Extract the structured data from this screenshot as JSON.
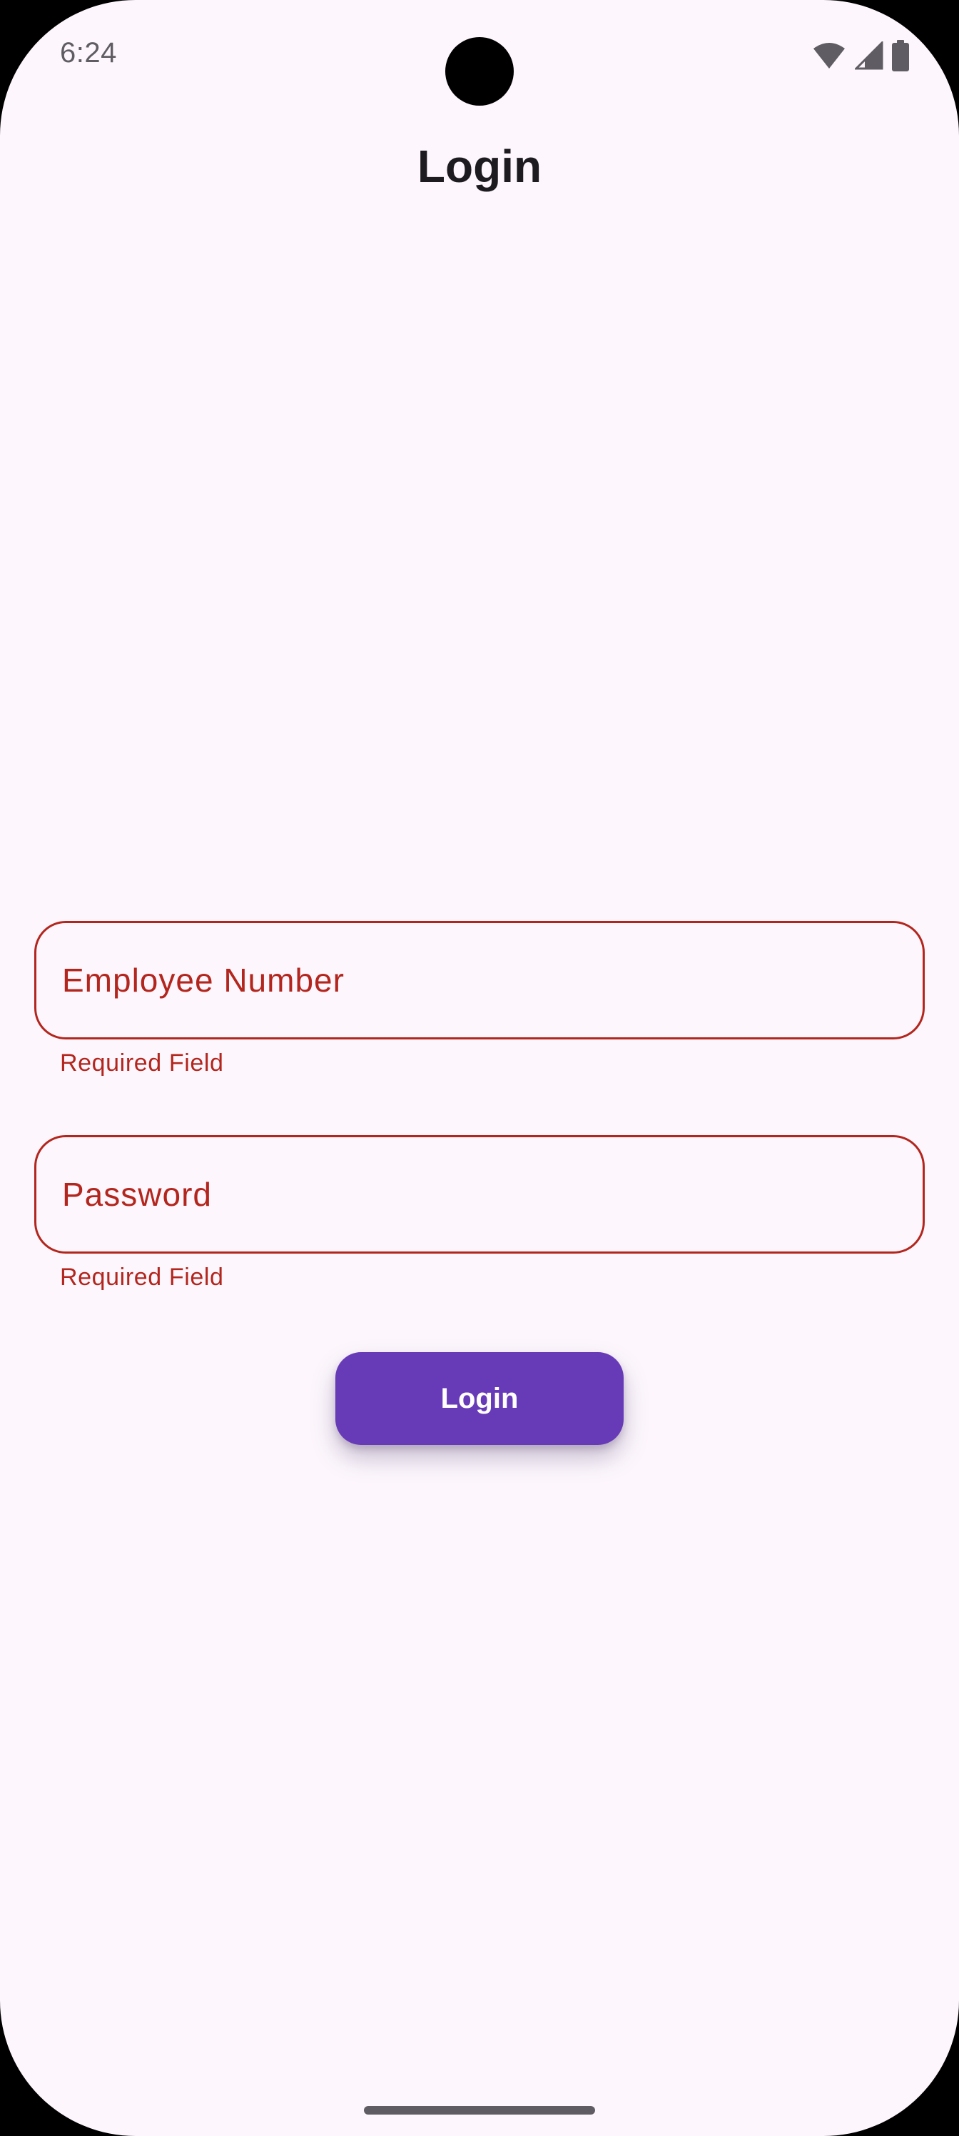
{
  "status_bar": {
    "time": "6:24"
  },
  "header": {
    "title": "Login"
  },
  "form": {
    "employee_number": {
      "label": "Employee Number",
      "error": "Required Field"
    },
    "password": {
      "label": "Password",
      "error": "Required Field"
    },
    "login_button": {
      "label": "Login"
    }
  },
  "colors": {
    "background": "#FDF7FD",
    "error": "#B3261E",
    "primary": "#673AB7",
    "text": "#1D1B20"
  }
}
